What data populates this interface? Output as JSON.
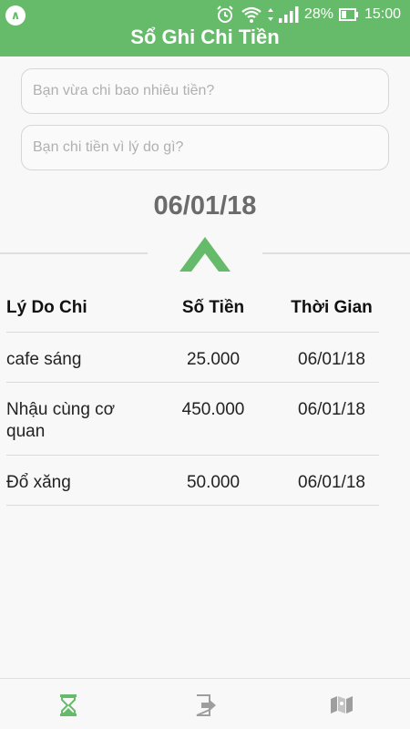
{
  "status_bar": {
    "battery": "28%",
    "time": "15:00",
    "notification_icon": "a-icon"
  },
  "app": {
    "title": "Sổ Ghi Chi Tiền"
  },
  "form": {
    "amount_placeholder": "Bạn vừa chi bao nhiêu tiền?",
    "reason_placeholder": "Bạn chi tiền vì lý do gì?"
  },
  "date": "06/01/18",
  "table": {
    "headers": [
      "Lý Do Chi",
      "Số Tiền",
      "Thời Gian"
    ],
    "rows": [
      {
        "reason": "cafe sáng",
        "amount": "25.000",
        "time": "06/01/18"
      },
      {
        "reason": "Nhậu cùng cơ quan",
        "amount": "450.000",
        "time": "06/01/18"
      },
      {
        "reason": "Đổ xăng",
        "amount": "50.000",
        "time": "06/01/18"
      }
    ]
  },
  "nav": [
    "hourglass-icon",
    "exit-icon",
    "map-icon"
  ],
  "colors": {
    "accent": "#66bb6a",
    "date_text": "#6b6b6b"
  }
}
